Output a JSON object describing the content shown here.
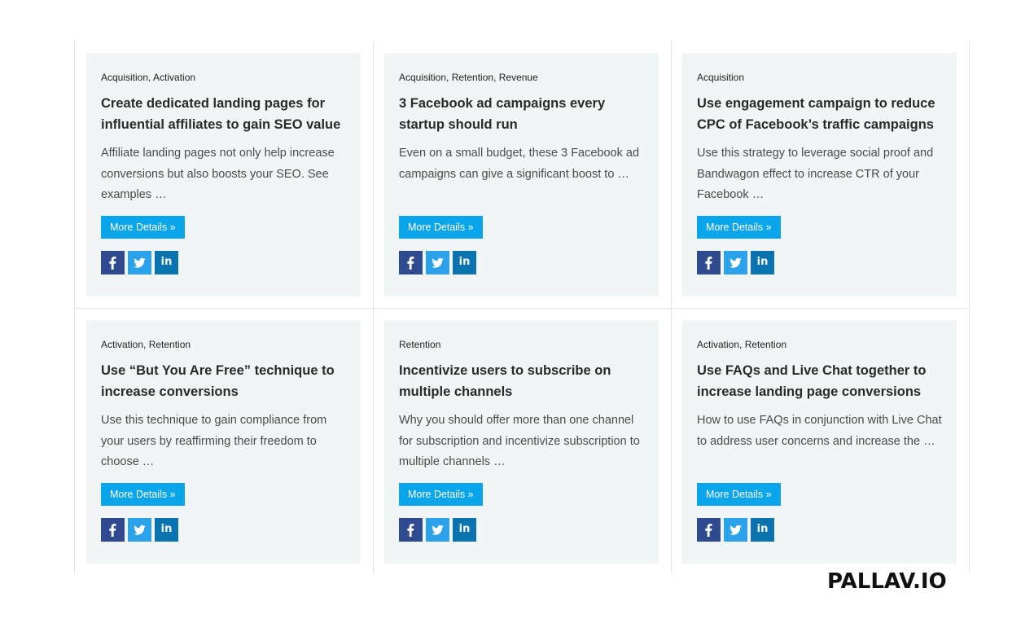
{
  "cards": [
    {
      "tags": "Acquisition, Activation",
      "title": "Create dedicated landing pages for influential affiliates to gain SEO value",
      "excerpt": "Affiliate landing pages not only help increase conversions but also boosts your SEO. See examples …",
      "button_label": "More Details »"
    },
    {
      "tags": "Acquisition, Retention, Revenue",
      "title": "3 Facebook ad campaigns every startup should run",
      "excerpt": "Even on a small budget, these 3 Facebook ad campaigns can give a significant boost to …",
      "button_label": "More Details »"
    },
    {
      "tags": "Acquisition",
      "title": "Use engagement campaign to reduce CPC of Facebook’s traffic campaigns",
      "excerpt": "Use this strategy to leverage social proof and Bandwagon effect to increase CTR of your Facebook …",
      "button_label": "More Details »"
    },
    {
      "tags": "Activation, Retention",
      "title": "Use “But You Are Free” technique to increase conversions",
      "excerpt": "Use this technique to gain compliance from your users by reaffirming their freedom to choose …",
      "button_label": "More Details »"
    },
    {
      "tags": "Retention",
      "title": "Incentivize users to subscribe on multiple channels",
      "excerpt": "Why you should offer more than one channel for subscription and incentivize subscription to multiple channels …",
      "button_label": "More Details »"
    },
    {
      "tags": "Activation, Retention",
      "title": "Use FAQs and Live Chat together to increase landing page conversions",
      "excerpt": "How to use FAQs in conjunction with Live Chat to address user concerns and increase the …",
      "button_label": "More Details »"
    }
  ],
  "share_icons": [
    {
      "name": "facebook-icon",
      "glyph": "f",
      "color": "#2f4a8e"
    },
    {
      "name": "twitter-icon",
      "glyph": "bird",
      "color": "#2ba2ea"
    },
    {
      "name": "linkedin-icon",
      "glyph": "in",
      "color": "#0c73b1"
    }
  ],
  "colors": {
    "card_background": "#f2f5f6",
    "button_background": "#0ba5ec",
    "divider": "#e4e6e8"
  },
  "brand": {
    "logo_text": "PALLAV.IO"
  }
}
